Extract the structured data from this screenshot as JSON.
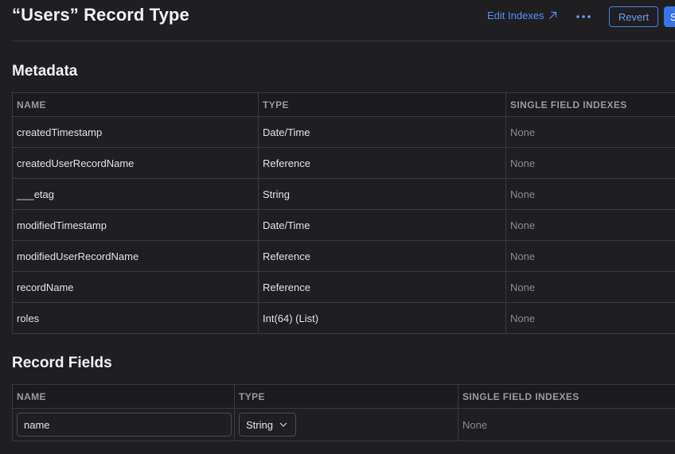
{
  "header": {
    "title": "“Users” Record Type",
    "edit_indexes_label": "Edit Indexes",
    "revert_label": "Revert",
    "save_label": "S"
  },
  "metadata": {
    "title": "Metadata",
    "columns": [
      "NAME",
      "TYPE",
      "SINGLE FIELD INDEXES"
    ],
    "rows": [
      {
        "name": "createdTimestamp",
        "type": "Date/Time",
        "indexes": "None"
      },
      {
        "name": "createdUserRecordName",
        "type": "Reference",
        "indexes": "None"
      },
      {
        "name": "___etag",
        "type": "String",
        "indexes": "None"
      },
      {
        "name": "modifiedTimestamp",
        "type": "Date/Time",
        "indexes": "None"
      },
      {
        "name": "modifiedUserRecordName",
        "type": "Reference",
        "indexes": "None"
      },
      {
        "name": "recordName",
        "type": "Reference",
        "indexes": "None"
      },
      {
        "name": "roles",
        "type": "Int(64) (List)",
        "indexes": "None"
      }
    ]
  },
  "record_fields": {
    "title": "Record Fields",
    "columns": [
      "NAME",
      "TYPE",
      "SINGLE FIELD INDEXES"
    ],
    "rows": [
      {
        "name": "name",
        "type": "String",
        "indexes": "None"
      }
    ]
  },
  "colors": {
    "background": "#1f1f21",
    "accent": "#3b73e6",
    "link": "#5a8ef5",
    "border": "#3a3a3d"
  },
  "icons": {
    "edit_indexes": "arrow-up-right-icon",
    "more": "ellipsis-icon",
    "select": "chevron-down-icon"
  }
}
